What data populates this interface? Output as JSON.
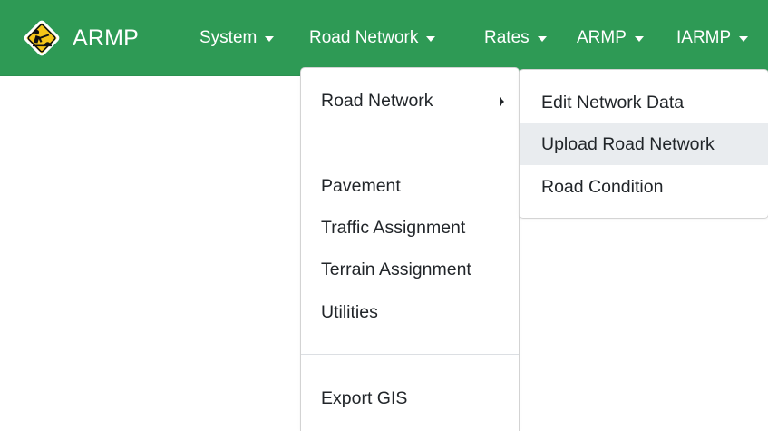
{
  "brand": {
    "name": "ARMP",
    "logo_icon": "road-work-sign-icon"
  },
  "colors": {
    "navbar_bg": "#2e9a55",
    "logo_sign_yellow": "#f5c518",
    "dropdown_active_bg": "#e9ecef"
  },
  "nav": {
    "items": [
      {
        "label": "System"
      },
      {
        "label": "Road Network"
      },
      {
        "label": "Rates"
      },
      {
        "label": "ARMP"
      },
      {
        "label": "IARMP"
      }
    ]
  },
  "road_network_menu": {
    "items": [
      {
        "label": "Road Network",
        "has_submenu": true
      },
      {
        "label": "Pavement"
      },
      {
        "label": "Traffic Assignment"
      },
      {
        "label": "Terrain Assignment"
      },
      {
        "label": "Utilities"
      },
      {
        "label": "Export GIS"
      }
    ]
  },
  "road_network_submenu": {
    "items": [
      {
        "label": "Edit Network Data"
      },
      {
        "label": "Upload Road Network",
        "active": true
      },
      {
        "label": "Road Condition"
      }
    ]
  }
}
